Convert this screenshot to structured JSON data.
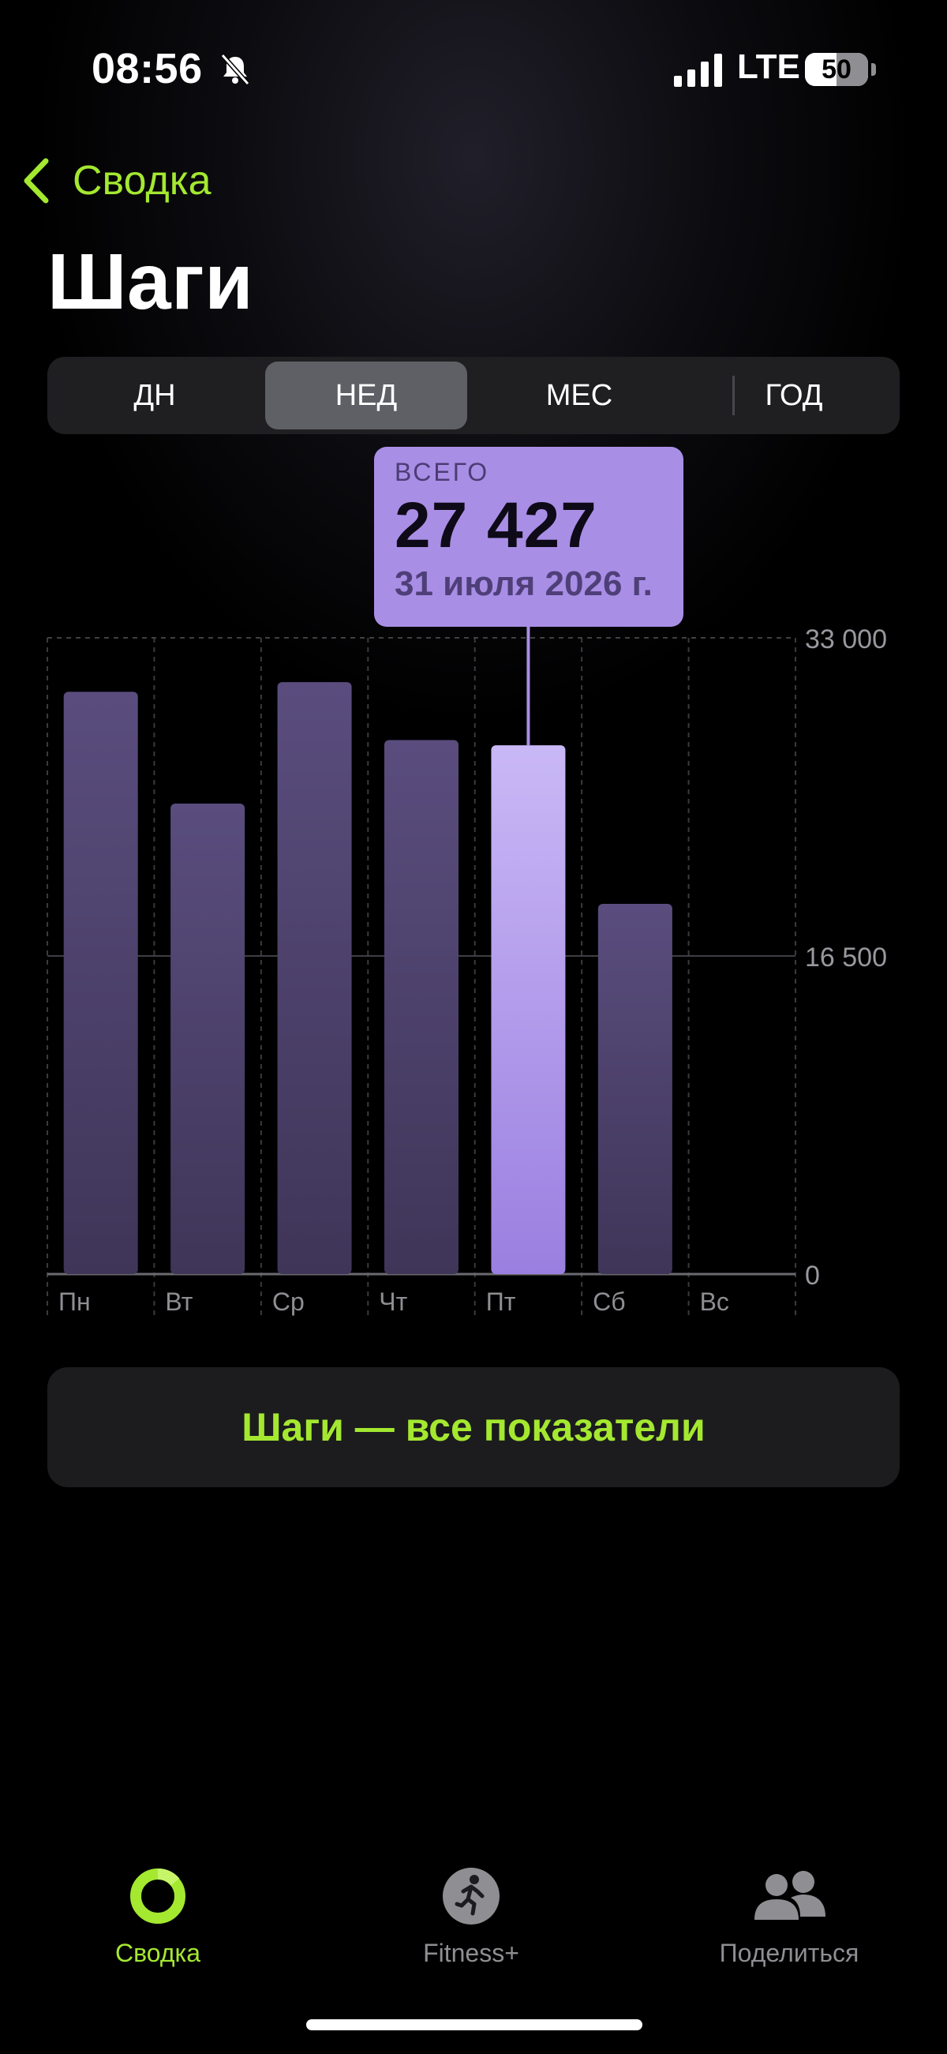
{
  "status_bar": {
    "time": "08:56",
    "network": "LTE",
    "battery": "50"
  },
  "nav": {
    "back_label": "Сводка"
  },
  "page": {
    "title": "Шаги"
  },
  "segments": [
    {
      "label": "ДН",
      "active": false
    },
    {
      "label": "НЕД",
      "active": true
    },
    {
      "label": "МЕС",
      "active": false
    },
    {
      "label": "ГОД",
      "active": false
    }
  ],
  "tooltip": {
    "label": "ВСЕГО",
    "value": "27 427",
    "date": "31 июля 2026 г."
  },
  "chart_data": {
    "type": "bar",
    "categories": [
      "Пн",
      "Вт",
      "Ср",
      "Чт",
      "Пт",
      "Сб",
      "Вс"
    ],
    "values": [
      30200,
      24400,
      30700,
      27700,
      27427,
      19200,
      0
    ],
    "highlighted_index": 4,
    "ylim": [
      0,
      33000
    ],
    "y_ticks": [
      0,
      16500,
      33000
    ],
    "y_tick_labels": [
      "0",
      "16 500",
      "33 000"
    ],
    "grid": true,
    "colors": {
      "bar": "#57497a",
      "bar_bottom": "#3e3456",
      "highlight_top": "#c7b6f5",
      "highlight_bottom": "#9c80e0"
    }
  },
  "actions": {
    "all_metrics": "Шаги — все показатели"
  },
  "tabbar": [
    {
      "label": "Сводка",
      "icon": "activity-ring-icon",
      "active": true,
      "color": "#a4e830"
    },
    {
      "label": "Fitness+",
      "icon": "running-figure-icon",
      "active": false,
      "color": "#8e8e93"
    },
    {
      "label": "Поделиться",
      "icon": "people-icon",
      "active": false,
      "color": "#8e8e93"
    }
  ]
}
